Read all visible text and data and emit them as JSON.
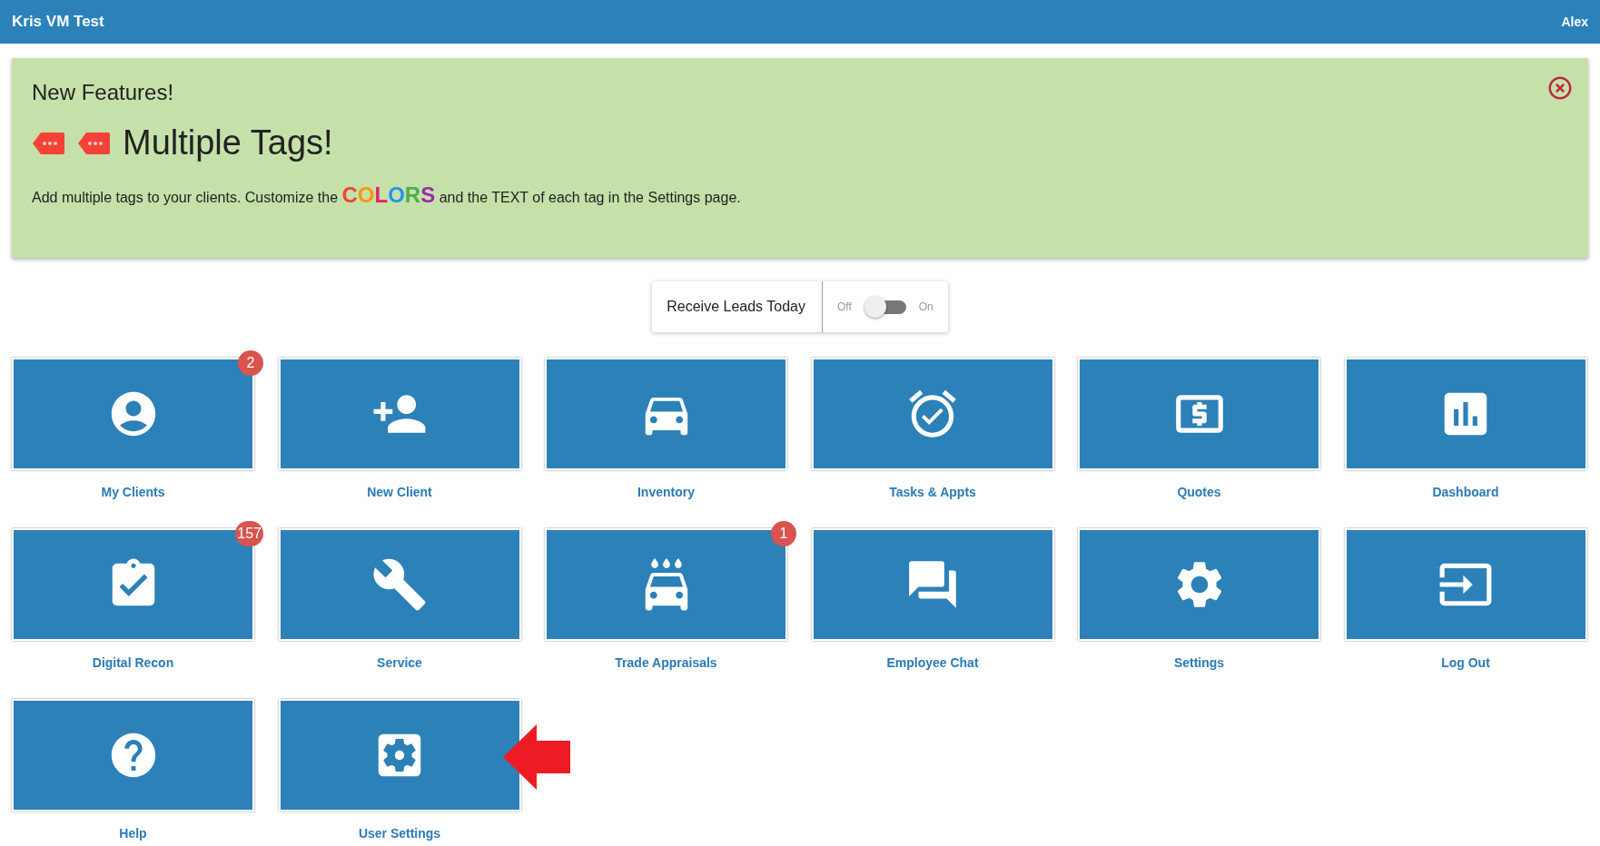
{
  "header": {
    "title": "Kris VM Test",
    "user": "Alex"
  },
  "banner": {
    "heading": "New Features!",
    "title": "Multiple Tags!",
    "text_before": "Add multiple tags to your clients. Customize the ",
    "colored_word": [
      {
        "text": "C",
        "color": "#f44336"
      },
      {
        "text": "O",
        "color": "#ff9800"
      },
      {
        "text": "L",
        "color": "#e91e63"
      },
      {
        "text": "O",
        "color": "#2196f3"
      },
      {
        "text": "R",
        "color": "#4caf50"
      },
      {
        "text": "S",
        "color": "#9c27b0"
      }
    ],
    "text_after": " and the TEXT of each tag in the Settings page."
  },
  "leads_toggle": {
    "label": "Receive Leads Today",
    "off_label": "Off",
    "on_label": "On",
    "on": false
  },
  "tiles": [
    {
      "kind": "clients",
      "label": "My Clients",
      "badge": "2"
    },
    {
      "kind": "new-client",
      "label": "New Client"
    },
    {
      "kind": "inventory",
      "label": "Inventory"
    },
    {
      "kind": "tasks",
      "label": "Tasks & Appts"
    },
    {
      "kind": "quotes",
      "label": "Quotes"
    },
    {
      "kind": "dashboard",
      "label": "Dashboard"
    },
    {
      "kind": "recon",
      "label": "Digital Recon",
      "badge": "157"
    },
    {
      "kind": "service",
      "label": "Service"
    },
    {
      "kind": "appraisals",
      "label": "Trade Appraisals",
      "badge": "1"
    },
    {
      "kind": "chat",
      "label": "Employee Chat"
    },
    {
      "kind": "settings",
      "label": "Settings"
    },
    {
      "kind": "logout",
      "label": "Log Out"
    },
    {
      "kind": "help",
      "label": "Help"
    },
    {
      "kind": "user-settings",
      "label": "User Settings",
      "pointer": true
    }
  ]
}
